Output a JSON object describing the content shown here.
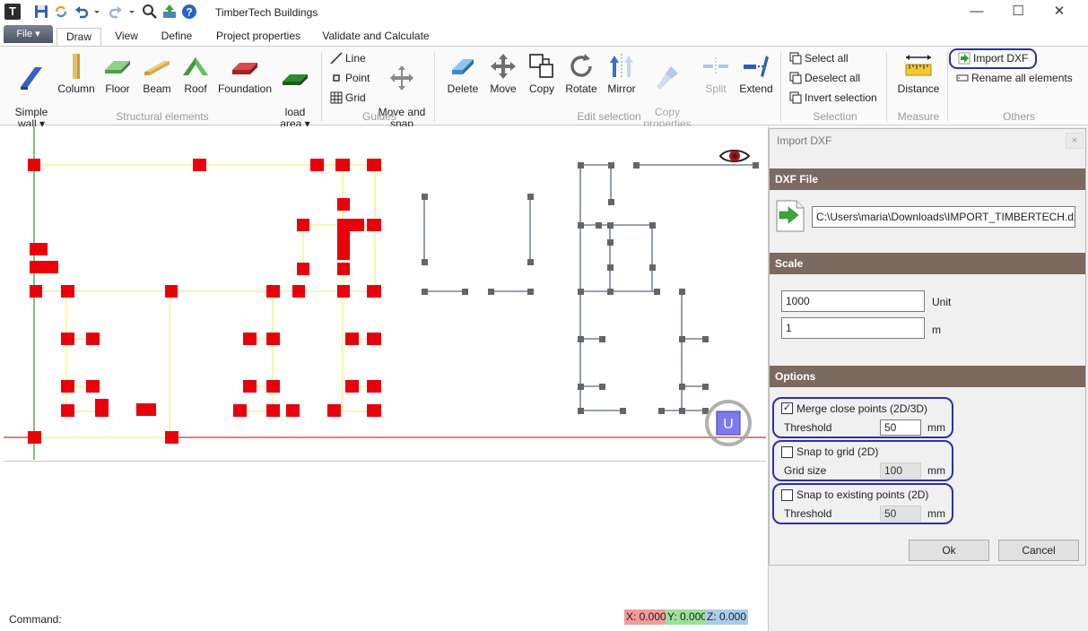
{
  "window": {
    "title": "TimberTech Buildings",
    "logo_letter": "T",
    "controls": {
      "minimize": "—",
      "maximize": "☐",
      "close": "✕"
    }
  },
  "ribbon": {
    "file_label": "File ▾",
    "tabs": [
      "Draw",
      "View",
      "Define",
      "Project properties",
      "Validate and Calculate"
    ],
    "active_tab": "Draw",
    "groups": {
      "structural": {
        "label": "Structural elements",
        "items": {
          "simple_wall": "Simple\nwall ▾",
          "column": "Column",
          "floor": "Floor",
          "beam": "Beam",
          "roof": "Roof",
          "foundation": "Foundation",
          "load_area": "load\narea ▾"
        }
      },
      "guides": {
        "label": "Guides",
        "items": {
          "line": "Line",
          "point": "Point",
          "grid": "Grid",
          "move_snap": "Move and\nsnap"
        }
      },
      "edit": {
        "label": "Edit selection",
        "items": {
          "delete": "Delete",
          "move": "Move",
          "copy": "Copy",
          "rotate": "Rotate",
          "mirror": "Mirror",
          "copy_properties": "Copy\nproperties",
          "split": "Split",
          "extend": "Extend"
        }
      },
      "selection": {
        "label": "Selection",
        "items": {
          "select_all": "Select all",
          "deselect_all": "Deselect all",
          "invert": "Invert selection"
        }
      },
      "measure": {
        "label": "Measure",
        "items": {
          "distance": "Distance"
        }
      },
      "others": {
        "label": "Others",
        "items": {
          "import_dxf": "Import DXF",
          "rename_all": "Rename all elements"
        }
      }
    }
  },
  "canvas": {
    "ucs_label": "U",
    "colors": {
      "node": "#e8000b",
      "wall_line": "#f1f17a",
      "dxf_line": "#5a6b80",
      "dxf_node": "#656565",
      "x_axis": "#c00000",
      "y_axis": "#008000"
    }
  },
  "command": {
    "label": "Command:",
    "coords": {
      "x": "X: 0.000",
      "y": "Y: 0.000",
      "z": "Z: 0.000"
    }
  },
  "dialog": {
    "title": "Import DXF",
    "close": "×",
    "sections": {
      "file": "DXF File",
      "scale": "Scale",
      "options": "Options"
    },
    "file_path": "C:\\Users\\maria\\Downloads\\IMPORT_TIMBERTECH.dxf",
    "scale": {
      "value1": "1000",
      "unit1": "Unit",
      "value2": "1",
      "unit2": "m"
    },
    "options": {
      "merge": {
        "label": "Merge close points (2D/3D)",
        "checked": true,
        "check_mark": "✓",
        "field_label": "Threshold",
        "value": "50",
        "unit": "mm"
      },
      "grid": {
        "label": "Snap to grid (2D)",
        "checked": false,
        "check_mark": "",
        "field_label": "Grid size",
        "value": "100",
        "unit": "mm"
      },
      "existing": {
        "label": "Snap to existing points (2D)",
        "checked": false,
        "check_mark": "",
        "field_label": "Threshold",
        "value": "50",
        "unit": "mm"
      }
    },
    "buttons": {
      "ok": "Ok",
      "cancel": "Cancel"
    }
  }
}
